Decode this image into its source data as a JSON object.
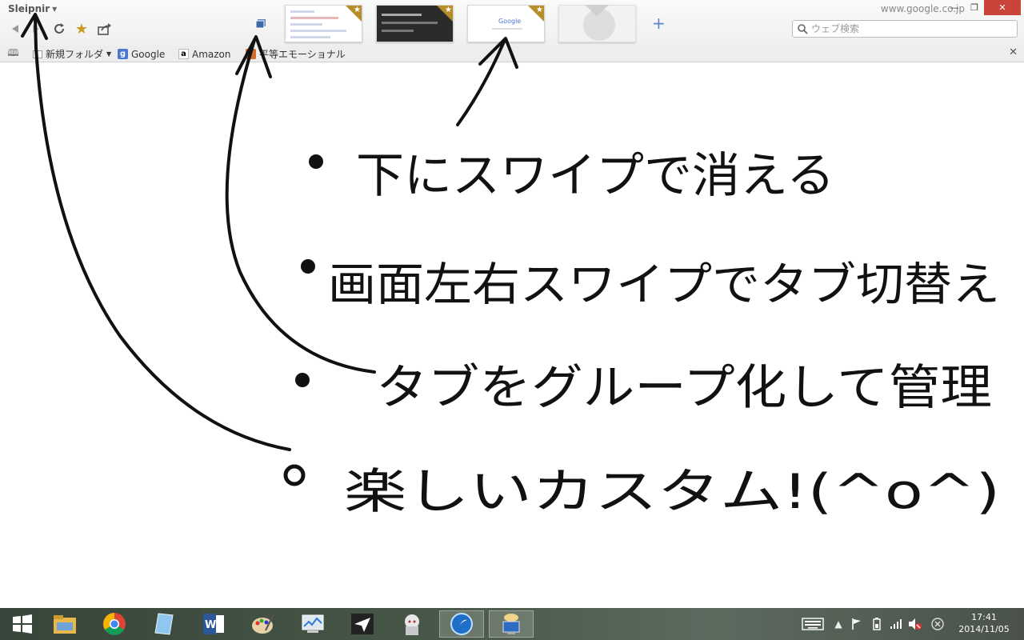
{
  "window": {
    "app_title": "Sleipnir",
    "url": "www.google.co.jp",
    "controls": {
      "minimize": "—",
      "restore": "❐",
      "close": "✕"
    }
  },
  "toolbar": {
    "buttons": [
      "back-icon",
      "forward-icon",
      "reload-icon",
      "star-icon",
      "share-icon",
      "tab-group-icon"
    ],
    "add_tab": "+",
    "search_placeholder": "ウェブ検索"
  },
  "tabs": [
    {
      "kind": "page-thumbnail",
      "starred": true
    },
    {
      "kind": "dark-page-thumbnail",
      "starred": true
    },
    {
      "kind": "google-thumbnail",
      "starred": true,
      "logo": "Google"
    },
    {
      "kind": "blank-globe",
      "starred": false
    }
  ],
  "bookmarks": {
    "items": [
      {
        "label": "新規フォルダ",
        "icon": "folder-icon",
        "has_menu": true
      },
      {
        "label": "Google",
        "icon": "google-icon"
      },
      {
        "label": "Amazon",
        "icon": "amazon-icon"
      },
      {
        "label": "平等エモーショナル",
        "icon": "bookmark-image-icon"
      }
    ],
    "close": "✕"
  },
  "annotations": {
    "lines": [
      "下にスワイプで消える",
      "画面左右スワイプでタブ切替え",
      "タブをグループ化して管理",
      "楽しいカスタム!(^o^)"
    ]
  },
  "taskbar": {
    "apps": [
      "windows-start-icon",
      "file-explorer-icon",
      "chrome-icon",
      "notepad-icon",
      "word-icon",
      "paint-icon",
      "task-manager-icon",
      "paper-plane-icon",
      "anime-character-icon",
      "sleipnir-icon",
      "network-computer-icon"
    ],
    "active_app": "sleipnir-icon",
    "clock": {
      "time": "17:41",
      "date": "2014/11/05"
    }
  },
  "colors": {
    "close_button": "#c9443a",
    "star": "#b58e2a",
    "accent_blue": "#5a86c4",
    "ink": "#111111"
  }
}
